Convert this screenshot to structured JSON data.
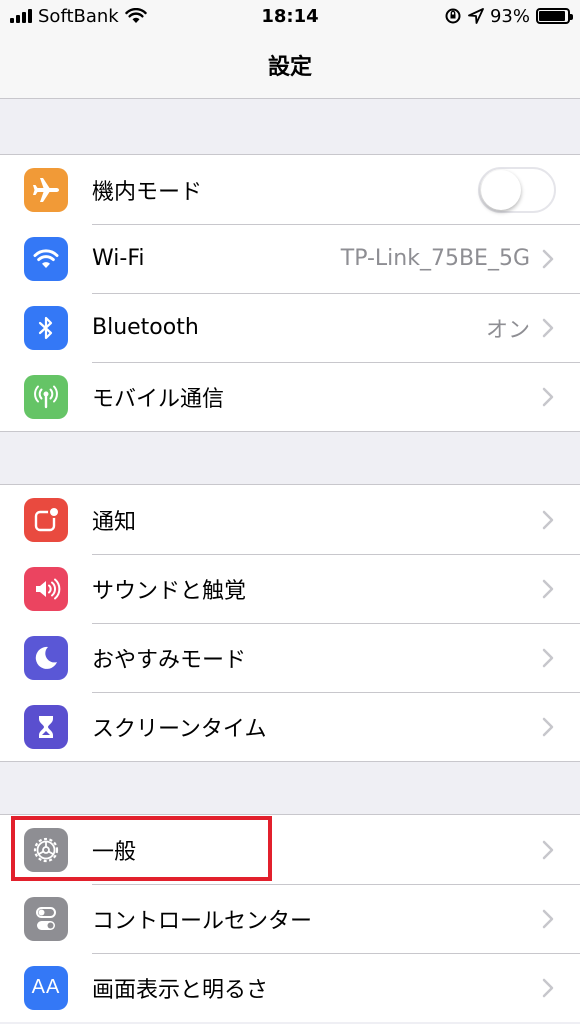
{
  "status_bar": {
    "carrier": "SoftBank",
    "time": "18:14",
    "battery": "93%",
    "battery_level": 0.93
  },
  "nav": {
    "title": "設定"
  },
  "groups": [
    {
      "rows": [
        {
          "label": "機内モード",
          "icon": "airplane-icon",
          "color": "#f19a37",
          "toggle": false
        },
        {
          "label": "Wi-Fi",
          "icon": "wifi-icon",
          "color": "#3478f6",
          "value": "TP-Link_75BE_5G"
        },
        {
          "label": "Bluetooth",
          "icon": "bluetooth-icon",
          "color": "#3478f6",
          "value": "オン"
        },
        {
          "label": "モバイル通信",
          "icon": "antenna-icon",
          "color": "#65c466"
        }
      ]
    },
    {
      "rows": [
        {
          "label": "通知",
          "icon": "notification-icon",
          "color": "#e94a3f"
        },
        {
          "label": "サウンドと触覚",
          "icon": "speaker-icon",
          "color": "#eb4460"
        },
        {
          "label": "おやすみモード",
          "icon": "moon-icon",
          "color": "#5a57d6"
        },
        {
          "label": "スクリーンタイム",
          "icon": "hourglass-icon",
          "color": "#5a4fcf"
        }
      ]
    },
    {
      "rows": [
        {
          "label": "一般",
          "icon": "gear-icon",
          "color": "#8e8e93"
        },
        {
          "label": "コントロールセンター",
          "icon": "switches-icon",
          "color": "#8e8e93"
        },
        {
          "label": "画面表示と明るさ",
          "icon": "text-size-icon",
          "color": "#3478f6",
          "icon_text": "AA"
        }
      ]
    }
  ],
  "highlight_color": "#e2202c"
}
